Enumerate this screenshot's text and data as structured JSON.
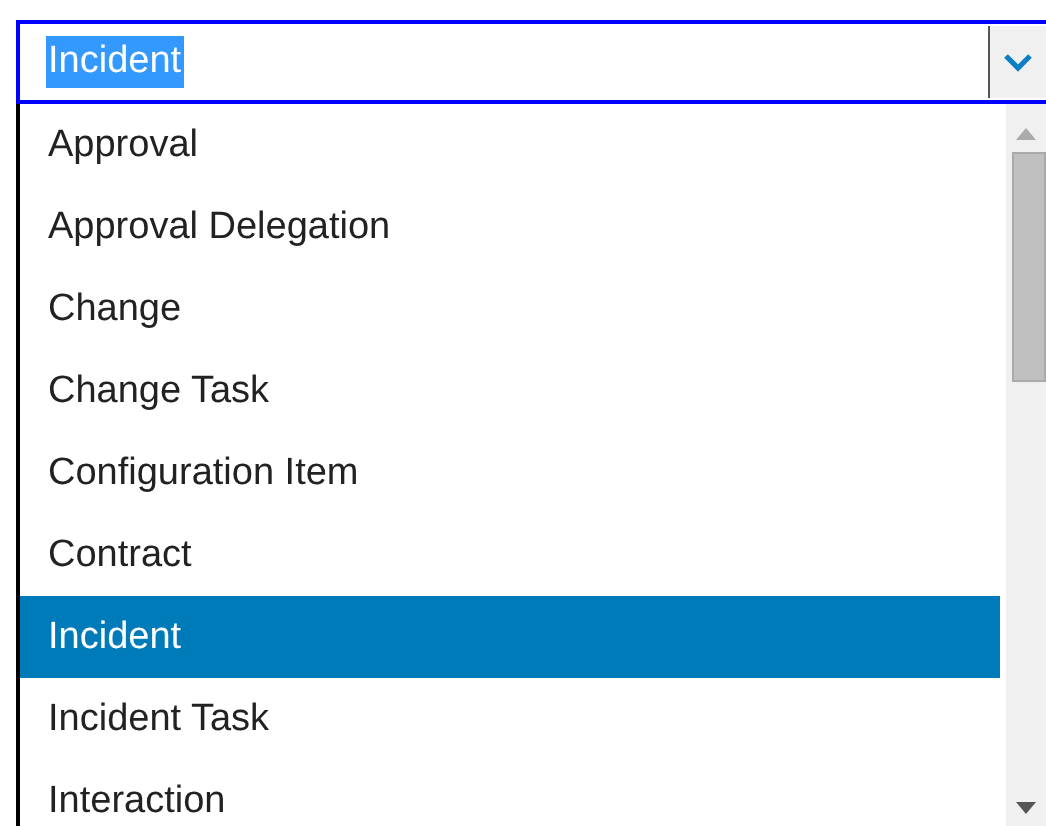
{
  "select": {
    "value": "Incident"
  },
  "options": [
    {
      "label": "Approval",
      "selected": false
    },
    {
      "label": "Approval Delegation",
      "selected": false
    },
    {
      "label": "Change",
      "selected": false
    },
    {
      "label": "Change Task",
      "selected": false
    },
    {
      "label": "Configuration Item",
      "selected": false
    },
    {
      "label": "Contract",
      "selected": false
    },
    {
      "label": "Incident",
      "selected": true
    },
    {
      "label": "Incident Task",
      "selected": false
    },
    {
      "label": "Interaction",
      "selected": false
    }
  ]
}
